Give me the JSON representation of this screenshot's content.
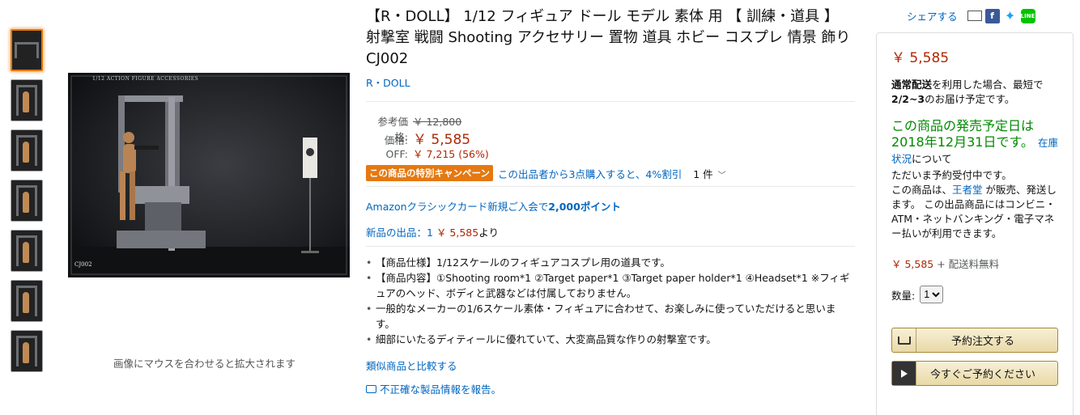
{
  "thumbnails": [
    {
      "label": "thumb-1"
    },
    {
      "label": "thumb-2"
    },
    {
      "label": "thumb-3"
    },
    {
      "label": "thumb-4"
    },
    {
      "label": "thumb-5"
    },
    {
      "label": "thumb-6"
    },
    {
      "label": "thumb-7"
    }
  ],
  "image": {
    "header_text": "1/12 ACTION FIGURE ACCESSORIES",
    "code_text": "CJ002",
    "hover_hint": "画像にマウスを合わせると拡大されます"
  },
  "product": {
    "title": "【R・DOLL】 1/12 フィギュア ドール モデル 素体 用 【 訓練・道具 】 射撃室 戦闘 Shooting アクセサリー 置物 道具 ホビー コスプレ 情景 飾り CJ002",
    "brand": "R・DOLL"
  },
  "pricing": {
    "ref_label": "参考価格:",
    "ref_price": "￥ 12,800",
    "price_label": "価格:",
    "price": "￥ 5,585",
    "off_label": "OFF:",
    "off_value": "￥ 7,215 (56%)"
  },
  "promo": {
    "badge": "この商品の特別キャンペーン",
    "text": "この出品者から3点購入すると、4%割引",
    "count": "1 件"
  },
  "card_offer": {
    "prefix": "Amazonクラシックカード新規ご入会で",
    "points": "2,000ポイント"
  },
  "new_offers": {
    "label": "新品の出品：1",
    "price": "￥ 5,585",
    "suffix": "より"
  },
  "bullets": [
    "【商品仕様】1/12スケールのフィギュアコスプレ用の道具です。",
    "【商品内容】①Shooting room*1 ②Target paper*1 ③Target paper holder*1 ④Headset*1 ※フィギュアのヘッド、ボディと武器などは付属しておりません。",
    "一般的なメーカーの1/6スケール素体・フィギュアに合わせて、お楽しみに使っていただけると思います。",
    "細部にいたるディティールに優れていて、大変高品質な作りの射撃室です。"
  ],
  "links": {
    "compare": "類似商品と比較する",
    "report": "不正確な製品情報を報告。"
  },
  "share": {
    "label": "シェアする",
    "icons": [
      "mail-icon",
      "facebook-icon",
      "twitter-icon",
      "line-icon"
    ]
  },
  "buybox": {
    "price": "￥ 5,585",
    "ship_bold": "通常配送",
    "ship_text": "を利用した場合、最短で",
    "ship_date": "2/2~3",
    "ship_suffix": "のお届け予定です。",
    "release": "この商品の発売予定日は2018年12月31日です。",
    "stock_link": "在庫状況",
    "stock_suffix": "について",
    "preorder": "ただいま予約受付中です。",
    "seller_prefix": "この商品は、",
    "seller": "王者堂",
    "seller_suffix": " が販売、発送します。 この出品商品にはコンビニ・ATM・ネットバンキング・電子マネー払いが利用できます。",
    "price2": "￥ 5,585",
    "shipping_free": " + 配送料無料",
    "qty_label": "数量:",
    "qty_value": "1",
    "btn_preorder": "予約注文する",
    "btn_now": "今すぐご予約ください"
  },
  "colors": {
    "price_red": "#b12704",
    "link_blue": "#0066c0",
    "promo_orange": "#e47911",
    "green": "#008a00"
  }
}
